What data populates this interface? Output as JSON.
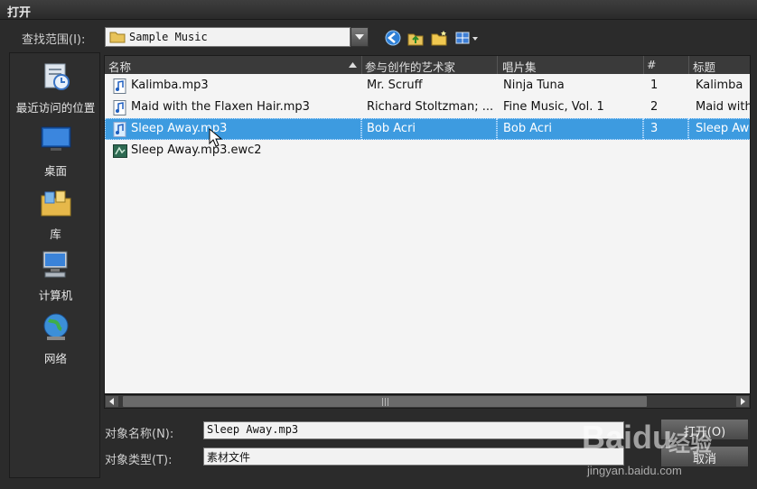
{
  "window": {
    "title": "打开"
  },
  "lookin": {
    "label": "查找范围(I):",
    "value": "Sample Music"
  },
  "toolbar": {
    "icons": [
      "back-icon",
      "up-folder-icon",
      "new-folder-icon",
      "view-menu-icon"
    ]
  },
  "places": [
    {
      "label": "最近访问的位置",
      "icon": "recent-places-icon"
    },
    {
      "label": "桌面",
      "icon": "desktop-icon"
    },
    {
      "label": "库",
      "icon": "libraries-icon"
    },
    {
      "label": "计算机",
      "icon": "computer-icon"
    },
    {
      "label": "网络",
      "icon": "network-icon"
    }
  ],
  "columns": {
    "name": "名称",
    "artist": "参与创作的艺术家",
    "album": "唱片集",
    "num": "#",
    "title": "标题"
  },
  "files": [
    {
      "name": "Kalimba.mp3",
      "artist": "Mr. Scruff",
      "album": "Ninja Tuna",
      "num": "1",
      "title": "Kalimba",
      "type": "audio"
    },
    {
      "name": "Maid with the Flaxen Hair.mp3",
      "artist": "Richard Stoltzman; ...",
      "album": "Fine Music, Vol. 1",
      "num": "2",
      "title": "Maid with",
      "type": "audio"
    },
    {
      "name": "Sleep Away.mp3",
      "artist": "Bob Acri",
      "album": "Bob Acri",
      "num": "3",
      "title": "Sleep Aw",
      "type": "audio",
      "selected": true
    },
    {
      "name": "Sleep Away.mp3.ewc2",
      "artist": "",
      "album": "",
      "num": "",
      "title": "",
      "type": "ewc"
    }
  ],
  "object_name": {
    "label": "对象名称(N):",
    "value": "Sleep Away.mp3"
  },
  "object_type": {
    "label": "对象类型(T):",
    "value": "素材文件"
  },
  "buttons": {
    "open": "打开(O)",
    "cancel": "取消"
  },
  "watermark": {
    "brand": "Baidu",
    "cn": "经验",
    "url": "jingyan.baidu.com"
  },
  "colors": {
    "selection": "#3d9be0",
    "background": "#2b2b2b",
    "list_bg": "#f4f4f4"
  }
}
